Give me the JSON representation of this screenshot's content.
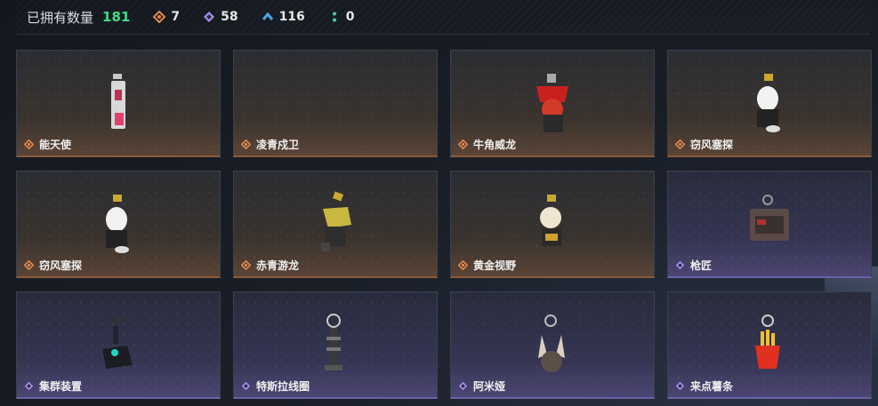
{
  "header": {
    "owned_label": "已拥有数量",
    "owned_count": "181",
    "stats": [
      {
        "icon": "orange-diamond-icon",
        "value": "7",
        "color": "#e38a4a"
      },
      {
        "icon": "purple-diamond-icon",
        "value": "58",
        "color": "#a98cf0"
      },
      {
        "icon": "blue-chevron-icon",
        "value": "116",
        "color": "#4aa8e8"
      },
      {
        "icon": "teal-dots-icon",
        "value": "0",
        "color": "#3ccfb0"
      }
    ]
  },
  "items": [
    {
      "name": "能天使",
      "rarity": "orange"
    },
    {
      "name": "凌青戍卫",
      "rarity": "orange"
    },
    {
      "name": "牛角威龙",
      "rarity": "orange"
    },
    {
      "name": "窃风塞探",
      "rarity": "orange"
    },
    {
      "name": "窃风塞探",
      "rarity": "orange"
    },
    {
      "name": "赤青游龙",
      "rarity": "orange"
    },
    {
      "name": "黄金视野",
      "rarity": "orange"
    },
    {
      "name": "枪匠",
      "rarity": "purple"
    },
    {
      "name": "集群装置",
      "rarity": "purple"
    },
    {
      "name": "特斯拉线圈",
      "rarity": "purple"
    },
    {
      "name": "阿米娅",
      "rarity": "purple"
    },
    {
      "name": "来点薯条",
      "rarity": "purple"
    }
  ],
  "colors": {
    "orange": "#e38a4a",
    "purple": "#a98cf0",
    "green": "#3ddc84"
  }
}
